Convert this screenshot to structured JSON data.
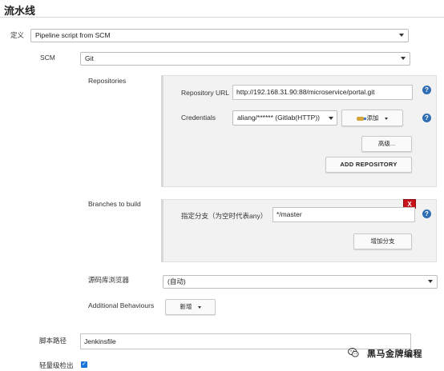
{
  "section": {
    "title": "流水线"
  },
  "definition": {
    "label": "定义",
    "value": "Pipeline script from SCM"
  },
  "scm": {
    "label": "SCM",
    "value": "Git"
  },
  "repositories": {
    "label": "Repositories",
    "url_label": "Repository URL",
    "url_value": "http://192.168.31.90:88/microservice/portal.git",
    "credentials_label": "Credentials",
    "credentials_value": "aliang/****** (Gitlab(HTTP))",
    "add_button": "添加",
    "advanced_button": "高级...",
    "add_repository_button": "ADD REPOSITORY"
  },
  "branches": {
    "label": "Branches to build",
    "specifier_label": "指定分支（为空时代表any）",
    "specifier_value": "*/master",
    "delete_button": "X",
    "add_branch_button": "增加分支"
  },
  "repo_browser": {
    "label": "源码库浏览器",
    "value": "(自动)"
  },
  "additional_behaviours": {
    "label": "Additional Behaviours",
    "add_button": "新增"
  },
  "script_path": {
    "label": "脚本路径",
    "value": "Jenkinsfile"
  },
  "lightweight_checkout": {
    "label": "轻量级检出",
    "checked": true
  },
  "help": {
    "symbol": "?"
  },
  "watermark": {
    "text": "黑马金牌编程",
    "icon": "wechat-icon"
  },
  "colors": {
    "help": "#2f6db5",
    "delete": "#c7141a",
    "checkbox": "#1a73d9"
  }
}
